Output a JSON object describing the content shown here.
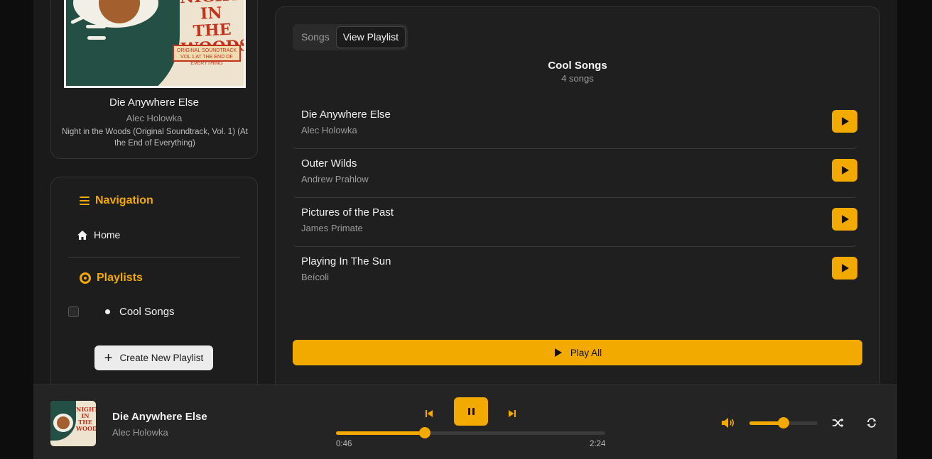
{
  "now_playing_card": {
    "title": "Die Anywhere Else",
    "artist": "Alec Holowka",
    "album": "Night in the Woods (Original Soundtrack, Vol. 1) (At the End of Everything)",
    "cover_art_text": {
      "title": "NIGHT IN THE WOODS",
      "subtitle": "ORIGINAL SOUNDTRACK VOL 1 AT THE END OF EVERYTHING"
    }
  },
  "sidebar": {
    "navigation_heading": "Navigation",
    "home_label": "Home",
    "playlists_heading": "Playlists",
    "playlists": [
      {
        "name": "Cool Songs",
        "checked": false
      }
    ],
    "create_button_label": "Create New Playlist"
  },
  "main": {
    "tabs": [
      {
        "label": "Songs",
        "active": false
      },
      {
        "label": "View Playlist",
        "active": true
      }
    ],
    "playlist_title": "Cool Songs",
    "playlist_count": "4 songs",
    "songs": [
      {
        "title": "Die Anywhere Else",
        "artist": "Alec Holowka"
      },
      {
        "title": "Outer Wilds",
        "artist": "Andrew Prahlow"
      },
      {
        "title": "Pictures of the Past",
        "artist": "James Primate"
      },
      {
        "title": "Playing In The Sun",
        "artist": "Beícoli"
      }
    ],
    "play_all_label": "Play All"
  },
  "player": {
    "title": "Die Anywhere Else",
    "artist": "Alec Holowka",
    "current_time": "0:46",
    "total_time": "2:24",
    "progress_fraction": 0.33,
    "volume_fraction": 0.5,
    "is_playing": true
  },
  "colors": {
    "accent": "#f2a900",
    "background": "#1a1a1a",
    "panel": "#1f1f1f"
  },
  "icons": [
    "hamburger-icon",
    "home-icon",
    "disc-icon",
    "plus-icon",
    "play-icon",
    "previous-icon",
    "pause-icon",
    "next-icon",
    "volume-icon",
    "shuffle-icon",
    "repeat-icon"
  ]
}
